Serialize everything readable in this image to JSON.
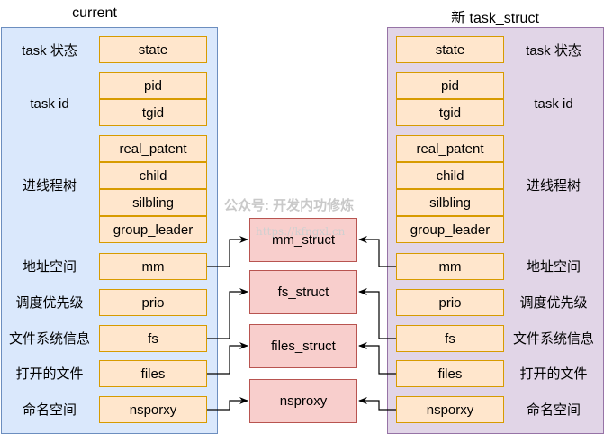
{
  "left": {
    "title": "current",
    "groups": [
      "task 状态",
      "task id",
      "进线程树",
      "地址空间",
      "调度优先级",
      "文件系统信息",
      "打开的文件",
      "命名空间"
    ],
    "fields": [
      "state",
      "pid",
      "tgid",
      "real_patent",
      "child",
      "silbling",
      "group_leader",
      "mm",
      "prio",
      "fs",
      "files",
      "nsporxy"
    ]
  },
  "right": {
    "title": "新 task_struct",
    "groups": [
      "task 状态",
      "task id",
      "进线程树",
      "地址空间",
      "调度优先级",
      "文件系统信息",
      "打开的文件",
      "命名空间"
    ],
    "fields": [
      "state",
      "pid",
      "tgid",
      "real_patent",
      "child",
      "silbling",
      "group_leader",
      "mm",
      "prio",
      "fs",
      "files",
      "nsporxy"
    ]
  },
  "shared": [
    "mm_struct",
    "fs_struct",
    "files_struct",
    "nsproxy"
  ],
  "watermark": {
    "text": "公众号: 开发内功修炼",
    "url": "https://kfngxl.cn"
  },
  "colors": {
    "current_panel": "#dae8fc",
    "new_panel": "#e1d5e7",
    "field": "#ffe6cc",
    "shared_struct": "#f8cecc"
  }
}
